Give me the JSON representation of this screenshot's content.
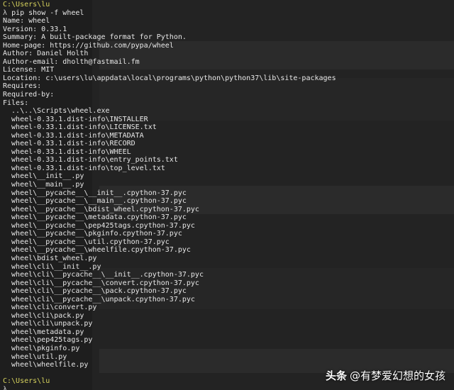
{
  "terminal": {
    "lines": [
      {
        "type": "path",
        "text": "C:\\Users\\lu"
      },
      {
        "type": "prompt",
        "symbol": "λ",
        "text": "pip show -f wheel"
      },
      {
        "type": "out",
        "text": "Name: wheel"
      },
      {
        "type": "out",
        "text": "Version: 0.33.1"
      },
      {
        "type": "out",
        "text": "Summary: A built-package format for Python."
      },
      {
        "type": "out",
        "text": "Home-page: https://github.com/pypa/wheel"
      },
      {
        "type": "out",
        "text": "Author: Daniel Holth"
      },
      {
        "type": "out",
        "text": "Author-email: dholth@fastmail.fm"
      },
      {
        "type": "out",
        "text": "License: MIT"
      },
      {
        "type": "out",
        "text": "Location: c:\\users\\lu\\appdata\\local\\programs\\python\\python37\\lib\\site-packages"
      },
      {
        "type": "out",
        "text": "Requires:"
      },
      {
        "type": "out",
        "text": "Required-by:"
      },
      {
        "type": "out",
        "text": "Files:"
      },
      {
        "type": "out",
        "text": "  ..\\..\\Scripts\\wheel.exe"
      },
      {
        "type": "out",
        "text": "  wheel-0.33.1.dist-info\\INSTALLER"
      },
      {
        "type": "out",
        "text": "  wheel-0.33.1.dist-info\\LICENSE.txt"
      },
      {
        "type": "out",
        "text": "  wheel-0.33.1.dist-info\\METADATA"
      },
      {
        "type": "out",
        "text": "  wheel-0.33.1.dist-info\\RECORD"
      },
      {
        "type": "out",
        "text": "  wheel-0.33.1.dist-info\\WHEEL"
      },
      {
        "type": "out",
        "text": "  wheel-0.33.1.dist-info\\entry_points.txt"
      },
      {
        "type": "out",
        "text": "  wheel-0.33.1.dist-info\\top_level.txt"
      },
      {
        "type": "out",
        "text": "  wheel\\__init__.py"
      },
      {
        "type": "out",
        "text": "  wheel\\__main__.py"
      },
      {
        "type": "out",
        "text": "  wheel\\__pycache__\\__init__.cpython-37.pyc"
      },
      {
        "type": "out",
        "text": "  wheel\\__pycache__\\__main__.cpython-37.pyc"
      },
      {
        "type": "out",
        "text": "  wheel\\__pycache__\\bdist_wheel.cpython-37.pyc"
      },
      {
        "type": "out",
        "text": "  wheel\\__pycache__\\metadata.cpython-37.pyc"
      },
      {
        "type": "out",
        "text": "  wheel\\__pycache__\\pep425tags.cpython-37.pyc"
      },
      {
        "type": "out",
        "text": "  wheel\\__pycache__\\pkginfo.cpython-37.pyc"
      },
      {
        "type": "out",
        "text": "  wheel\\__pycache__\\util.cpython-37.pyc"
      },
      {
        "type": "out",
        "text": "  wheel\\__pycache__\\wheelfile.cpython-37.pyc"
      },
      {
        "type": "out",
        "text": "  wheel\\bdist_wheel.py"
      },
      {
        "type": "out",
        "text": "  wheel\\cli\\__init__.py"
      },
      {
        "type": "out",
        "text": "  wheel\\cli\\__pycache__\\__init__.cpython-37.pyc"
      },
      {
        "type": "out",
        "text": "  wheel\\cli\\__pycache__\\convert.cpython-37.pyc"
      },
      {
        "type": "out",
        "text": "  wheel\\cli\\__pycache__\\pack.cpython-37.pyc"
      },
      {
        "type": "out",
        "text": "  wheel\\cli\\__pycache__\\unpack.cpython-37.pyc"
      },
      {
        "type": "out",
        "text": "  wheel\\cli\\convert.py"
      },
      {
        "type": "out",
        "text": "  wheel\\cli\\pack.py"
      },
      {
        "type": "out",
        "text": "  wheel\\cli\\unpack.py"
      },
      {
        "type": "out",
        "text": "  wheel\\metadata.py"
      },
      {
        "type": "out",
        "text": "  wheel\\pep425tags.py"
      },
      {
        "type": "out",
        "text": "  wheel\\pkginfo.py"
      },
      {
        "type": "out",
        "text": "  wheel\\util.py"
      },
      {
        "type": "out",
        "text": "  wheel\\wheelfile.py"
      },
      {
        "type": "out",
        "text": ""
      },
      {
        "type": "path",
        "text": "C:\\Users\\lu"
      },
      {
        "type": "prompt",
        "symbol": "λ",
        "text": ""
      }
    ]
  },
  "watermark": {
    "brand": "头条",
    "handle": "@有梦爱幻想的女孩"
  },
  "colors": {
    "background": "#1e1e1e",
    "text": "#e8e8e8",
    "path": "#d7d35d"
  }
}
